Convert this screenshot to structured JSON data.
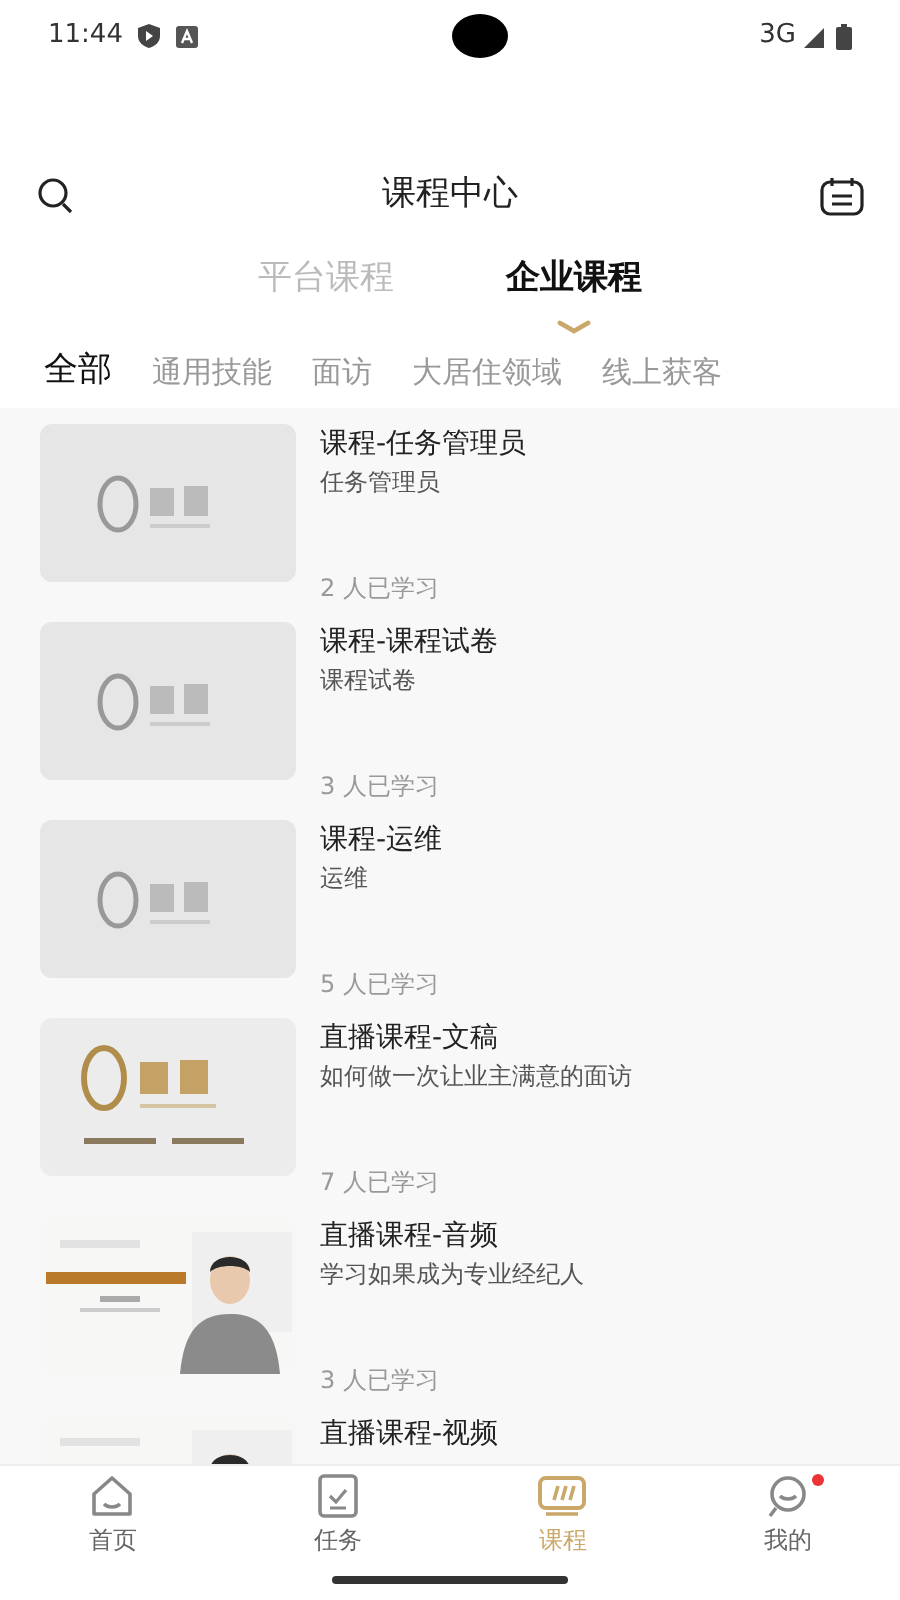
{
  "status_bar": {
    "time": "11:44",
    "network": "3G"
  },
  "header": {
    "title": "课程中心"
  },
  "source_tabs": [
    {
      "label": "平台课程",
      "selected": false
    },
    {
      "label": "企业课程",
      "selected": true
    }
  ],
  "categories": [
    {
      "label": "全部",
      "selected": true
    },
    {
      "label": "通用技能",
      "selected": false
    },
    {
      "label": "面访",
      "selected": false
    },
    {
      "label": "大居住领域",
      "selected": false
    },
    {
      "label": "线上获客",
      "selected": false
    }
  ],
  "courses": [
    {
      "title": "课程-任务管理员",
      "subtitle": "任务管理员",
      "learners": "2 人已学习",
      "kind": "placeholder"
    },
    {
      "title": "课程-课程试卷",
      "subtitle": "课程试卷",
      "learners": "3 人已学习",
      "kind": "placeholder"
    },
    {
      "title": "课程-运维",
      "subtitle": "运维",
      "learners": "5 人已学习",
      "kind": "placeholder"
    },
    {
      "title": "直播课程-文稿",
      "subtitle": "如何做一次让业主满意的面访",
      "learners": "7 人已学习",
      "kind": "logo"
    },
    {
      "title": "直播课程-音频",
      "subtitle": "学习如果成为专业经纪人",
      "learners": "3 人已学习",
      "kind": "portrait"
    },
    {
      "title": "直播课程-视频",
      "kind": "portrait"
    }
  ],
  "nav": [
    {
      "label": "首页",
      "kind": "home",
      "selected": false,
      "badge": false
    },
    {
      "label": "任务",
      "kind": "task",
      "selected": false,
      "badge": false
    },
    {
      "label": "课程",
      "kind": "course",
      "selected": true,
      "badge": false
    },
    {
      "label": "我的",
      "kind": "profile",
      "selected": false,
      "badge": true
    }
  ]
}
